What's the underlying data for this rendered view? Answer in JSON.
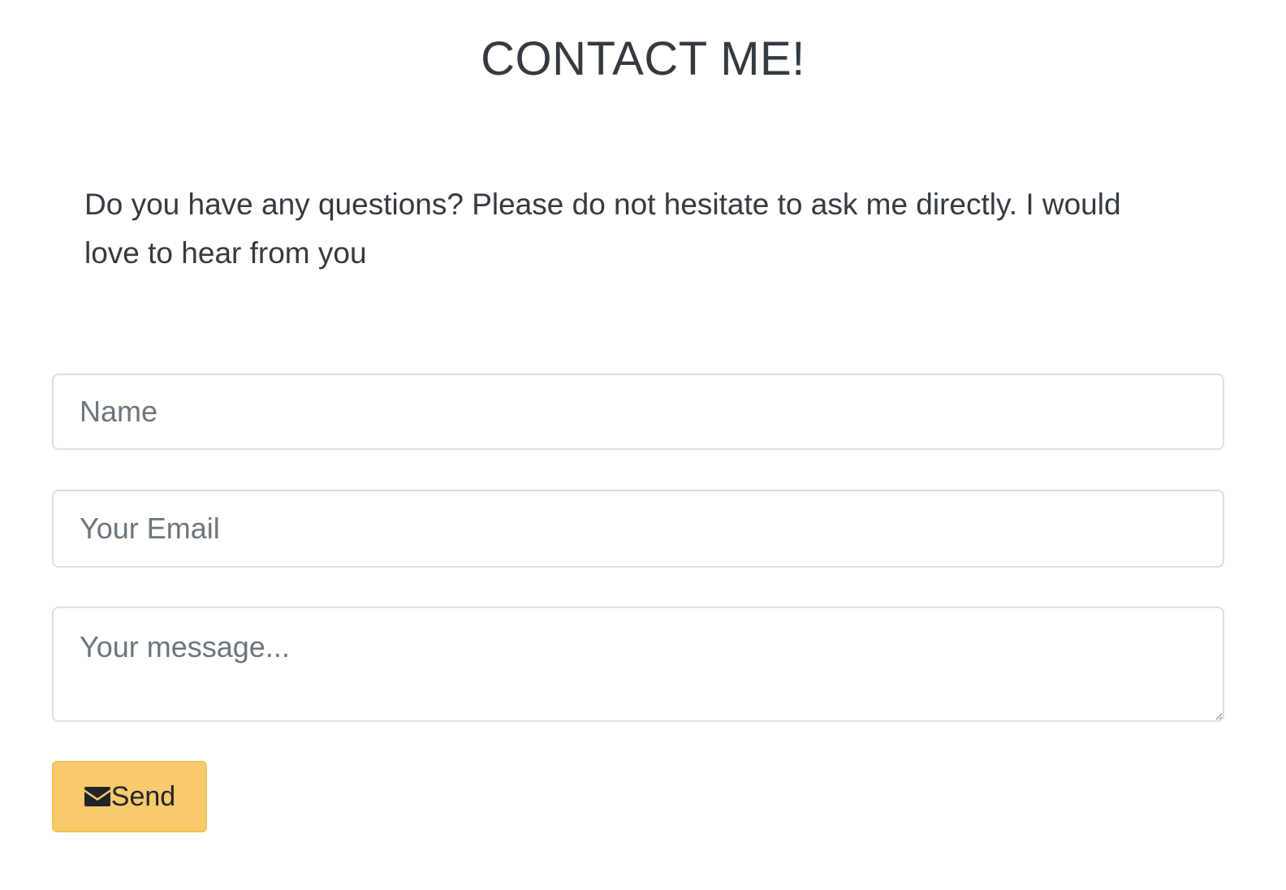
{
  "header": {
    "title": "CONTACT ME!"
  },
  "intro": {
    "text": "Do you have any questions? Please do not hesitate to ask me directly. I would love to hear from you"
  },
  "form": {
    "name_placeholder": "Name",
    "email_placeholder": "Your Email",
    "message_placeholder": "Your message...",
    "send_label": "Send",
    "send_icon": "envelope-icon"
  },
  "colors": {
    "button_background": "#f7ca6d",
    "button_border": "#f3c14f",
    "text": "#343a40",
    "input_border": "#dcdfe3"
  }
}
